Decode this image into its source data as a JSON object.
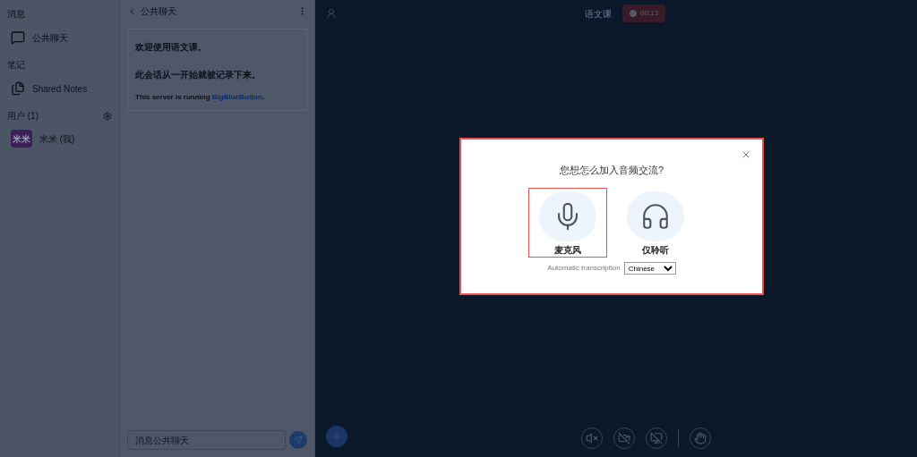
{
  "sidebar": {
    "messages_heading": "消息",
    "public_chat": "公共聊天",
    "notes_heading": "笔记",
    "shared_notes": "Shared Notes",
    "users_heading": "用户 (1)",
    "users": [
      {
        "avatar": "米米",
        "name": "米米 (我)"
      }
    ]
  },
  "chat": {
    "title": "公共聊天",
    "welcome": [
      "欢迎使用语文课。",
      "此会话从一开始就被记录下来。"
    ],
    "server_text": "This server is running ",
    "server_link": "BigBlueButton",
    "server_end": ".",
    "input": {
      "placeholder": "消息公共聊天"
    }
  },
  "header": {
    "meeting_title": "语文课",
    "recording": {
      "on": true,
      "time": "00:13"
    }
  },
  "modal": {
    "title": "您想怎么加入音频交流?",
    "options": [
      {
        "kind": "microphone",
        "label": "麦克风",
        "selected": true
      },
      {
        "kind": "listen",
        "label": "仅聆听",
        "selected": false
      }
    ],
    "transcription_label": "Automatic transcription",
    "transcription_value": "Chinese"
  },
  "toolbar": [
    {
      "kind": "audio"
    },
    {
      "kind": "video"
    },
    {
      "kind": "screen"
    },
    {
      "kind": "divider"
    },
    {
      "kind": "hand"
    }
  ]
}
